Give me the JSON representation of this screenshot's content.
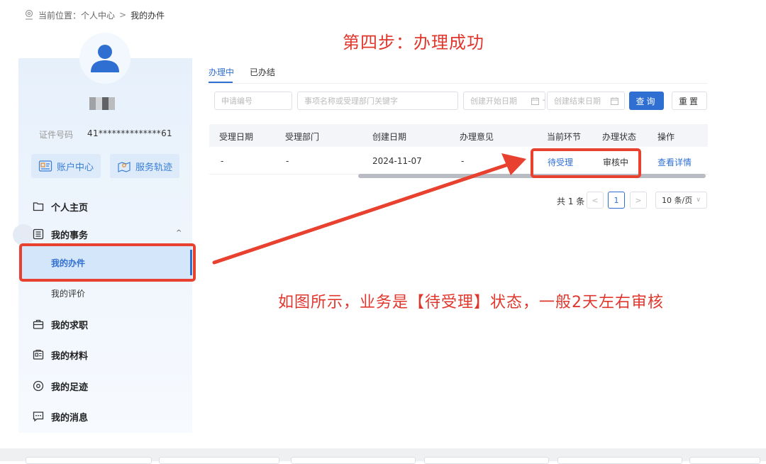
{
  "breadcrumb": {
    "prefix": "当前位置：",
    "parent": "个人中心",
    "separator": ">",
    "current": "我的办件"
  },
  "step_title": "第四步：办理成功",
  "profile": {
    "id_label": "证件号码",
    "id_value": "41**************61"
  },
  "quick_buttons": {
    "account": "账户中心",
    "service": "服务轨迹"
  },
  "menu": {
    "home": "个人主页",
    "affairs": "我的事务",
    "my_cases": "我的办件",
    "my_reviews": "我的评价",
    "jobs": "我的求职",
    "materials": "我的材料",
    "footprints": "我的足迹",
    "messages": "我的消息"
  },
  "tabs": {
    "in_progress": "办理中",
    "completed": "已办结"
  },
  "filters": {
    "app_no_placeholder": "申请编号",
    "keyword_placeholder": "事项名称或受理部门关键字",
    "start_date_placeholder": "创建开始日期",
    "end_date_placeholder": "创建结束日期",
    "range_dash": "-",
    "query_btn": "查询",
    "reset_btn": "重置"
  },
  "table": {
    "headers": {
      "accept_date": "受理日期",
      "accept_dept": "受理部门",
      "create_date": "创建日期",
      "opinion": "办理意见",
      "current_step": "当前环节",
      "status": "办理状态",
      "action": "操作"
    },
    "rows": [
      {
        "accept_date": "-",
        "accept_dept": "-",
        "create_date": "2024-11-07",
        "opinion": "-",
        "current_step": "待受理",
        "status": "审核中",
        "action": "查看详情"
      }
    ]
  },
  "pagination": {
    "total": "共 1 条",
    "prev": "<",
    "current": "1",
    "next": ">",
    "page_size": "10 条/页"
  },
  "annotation": "如图所示，业务是【待受理】状态，一般2天左右审核",
  "colors": {
    "accent_blue": "#2f6fd1",
    "annotation_red": "#e0372d",
    "highlight_red": "#e8412f"
  }
}
